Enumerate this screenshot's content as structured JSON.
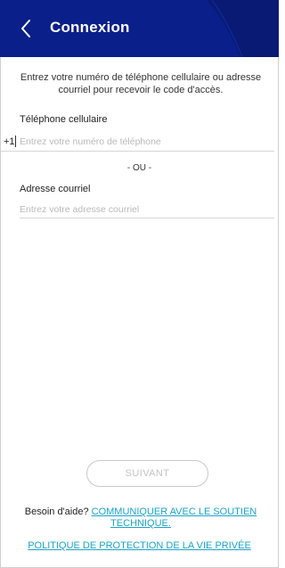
{
  "header": {
    "title": "Connexion",
    "background_color": "#0a1f8a",
    "back_icon": "chevron-left-icon"
  },
  "intro": {
    "text": "Entrez votre numéro de téléphone cellulaire ou adresse courriel pour recevoir le code d'accès."
  },
  "phone": {
    "label": "Téléphone cellulaire",
    "prefix": "+1",
    "value": "",
    "placeholder": "Entrez votre numéro de téléphone"
  },
  "divider": {
    "text": "- OU -"
  },
  "email": {
    "label": "Adresse courriel",
    "value": "",
    "placeholder": "Entrez votre adresse courriel"
  },
  "next_button": {
    "label": "SUIVANT",
    "enabled": false
  },
  "help": {
    "text": "Besoin d'aide?",
    "link_label": "COMMUNIQUER AVEC LE SOUTIEN TECHNIQUE."
  },
  "privacy": {
    "link_label": "POLITIQUE DE PROTECTION DE LA VIE PRIVÉE"
  },
  "colors": {
    "link": "#1aa3c9",
    "placeholder": "#b9b9b9"
  }
}
